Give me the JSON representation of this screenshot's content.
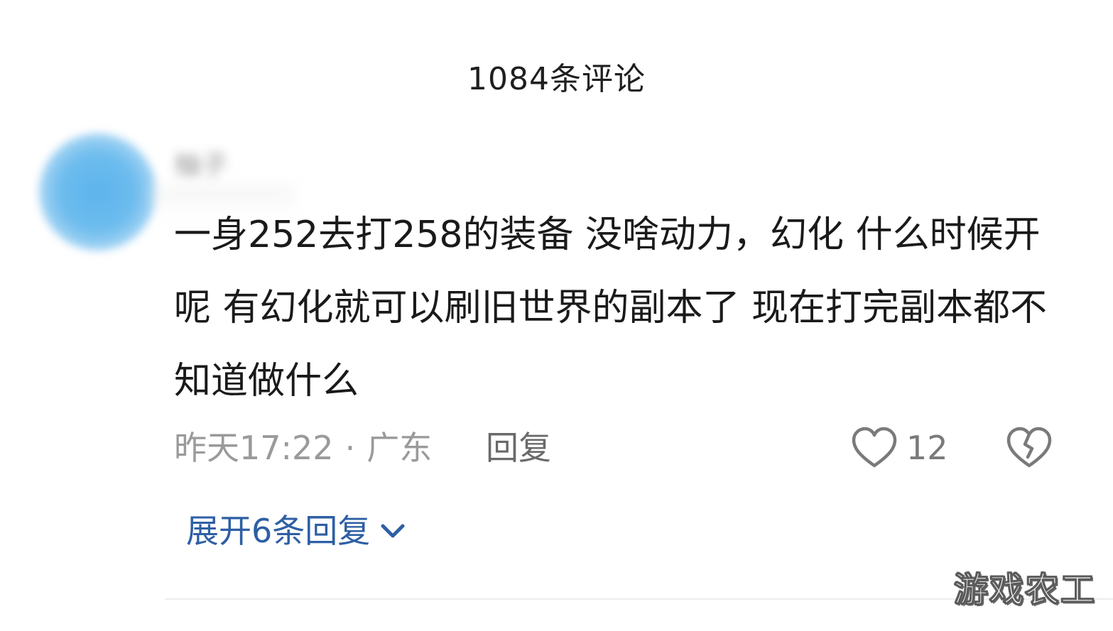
{
  "header": {
    "title": "1084条评论"
  },
  "comment": {
    "username": "柚子",
    "text": "一身252去打258的装备 没啥动力，幻化 什么时候开呢 有幻化就可以刷旧世界的副本了 现在打完副本都不知道做什么",
    "time": "昨天17:22",
    "separator": "·",
    "location": "广东",
    "reply_label": "回复",
    "like_count": "12",
    "expand_label": "展开6条回复"
  },
  "icons": {
    "like": "heart-outline-icon",
    "dislike": "broken-heart-icon",
    "expand": "chevron-down-icon"
  },
  "colors": {
    "expand_link": "#2e5fa4",
    "avatar": "#6dbcee",
    "meta_text": "#9a9a9a"
  },
  "watermark": {
    "text": "游戏农工"
  }
}
